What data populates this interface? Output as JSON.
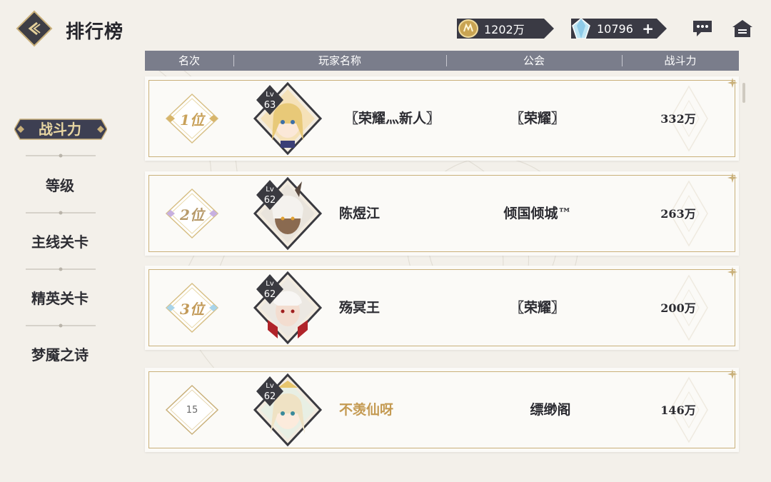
{
  "header": {
    "title": "排行榜",
    "gold_value": "1202万",
    "gem_value": "10796",
    "plus_label": "+"
  },
  "sidebar": {
    "items": [
      {
        "label": "战斗力",
        "active": true
      },
      {
        "label": "等级",
        "active": false
      },
      {
        "label": "主线关卡",
        "active": false
      },
      {
        "label": "精英关卡",
        "active": false
      },
      {
        "label": "梦魇之诗",
        "active": false
      }
    ]
  },
  "table": {
    "columns": [
      "名次",
      "玩家名称",
      "公会",
      "战斗力"
    ],
    "rows": [
      {
        "rank": "1位",
        "level_label": "Lv",
        "level": "63",
        "name": "〖荣耀灬新人〗",
        "guild": "〖荣耀〗",
        "power": "332万",
        "rank_color": "#c9a25b"
      },
      {
        "rank": "2位",
        "level_label": "Lv",
        "level": "62",
        "name": "陈煜江",
        "guild": "倾国倾城™",
        "power": "263万",
        "rank_color": "#b79a6a"
      },
      {
        "rank": "3位",
        "level_label": "Lv",
        "level": "62",
        "name": "殇冥王",
        "guild": "〖荣耀〗",
        "power": "200万",
        "rank_color": "#c39b5a"
      },
      {
        "rank": "15",
        "level_label": "Lv",
        "level": "62",
        "name": "不羡仙呀",
        "guild": "缥缈阁",
        "power": "146万",
        "self": true
      }
    ]
  },
  "colors": {
    "gold_accent": "#c9b07a",
    "header_bar": "#7a7d8b",
    "dark_panel": "#3a3a44",
    "self_name": "#c49a52"
  }
}
